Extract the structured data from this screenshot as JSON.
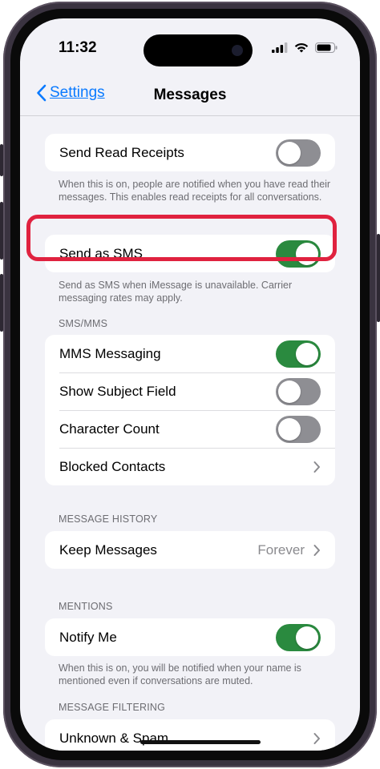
{
  "status_bar": {
    "time": "11:32"
  },
  "nav": {
    "back_label": "Settings",
    "title": "Messages"
  },
  "groups": {
    "read_receipts": {
      "label": "Send Read Receipts",
      "on": false,
      "footnote": "When this is on, people are notified when you have read their messages. This enables read receipts for all conversations."
    },
    "send_sms": {
      "label": "Send as SMS",
      "on": true,
      "footnote": "Send as SMS when iMessage is unavailable. Carrier messaging rates may apply."
    },
    "sms_mms": {
      "header": "SMS/MMS",
      "mms": {
        "label": "MMS Messaging",
        "on": true
      },
      "subject": {
        "label": "Show Subject Field",
        "on": false
      },
      "char_count": {
        "label": "Character Count",
        "on": false
      },
      "blocked": {
        "label": "Blocked Contacts"
      }
    },
    "history": {
      "header": "MESSAGE HISTORY",
      "label": "Keep Messages",
      "value": "Forever"
    },
    "mentions": {
      "header": "MENTIONS",
      "label": "Notify Me",
      "on": true,
      "footnote": "When this is on, you will be notified when your name is mentioned even if conversations are muted."
    },
    "filtering": {
      "header": "MESSAGE FILTERING",
      "label": "Unknown & Spam"
    }
  },
  "colors": {
    "accent": "#0a7aff",
    "toggle_on": "#2a8a3f",
    "toggle_off": "#8e8e93",
    "highlight": "#e0223f"
  },
  "icons": [
    "signal-icon",
    "wifi-icon",
    "battery-icon",
    "chevron-left-icon",
    "chevron-right-icon"
  ]
}
